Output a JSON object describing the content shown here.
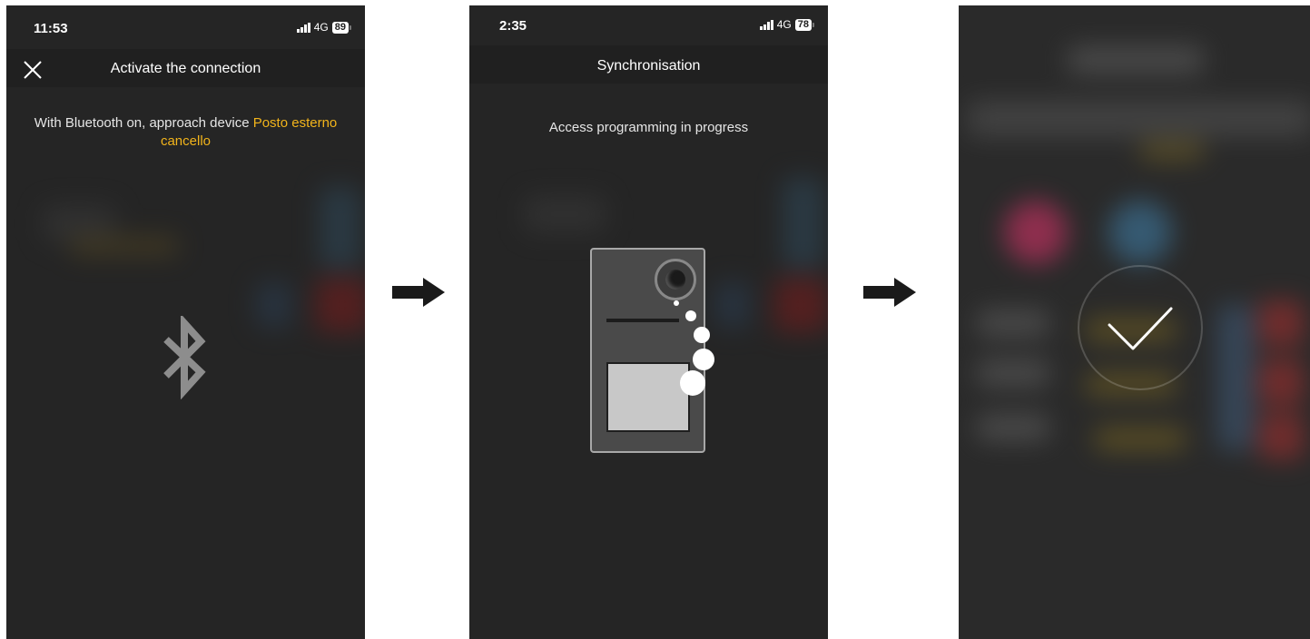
{
  "screen1": {
    "time": "11:53",
    "network": "4G",
    "battery": "89",
    "title": "Activate the connection",
    "message_prefix": "With Bluetooth on, approach device ",
    "message_device": "Posto esterno cancello",
    "icons": {
      "close": "close-icon",
      "bluetooth": "bluetooth-icon"
    }
  },
  "screen2": {
    "time": "2:35",
    "network": "4G",
    "battery": "78",
    "title": "Synchronisation",
    "message": "Access programming in progress",
    "icons": {
      "device": "door-station-icon",
      "signal": "signal-dots-icon"
    }
  },
  "screen3": {
    "icons": {
      "check": "checkmark-icon"
    }
  },
  "arrows": [
    "arrow-right-icon",
    "arrow-right-icon"
  ],
  "colors": {
    "highlight": "#f2b41b",
    "background": "#252525",
    "navbar": "#202020"
  }
}
